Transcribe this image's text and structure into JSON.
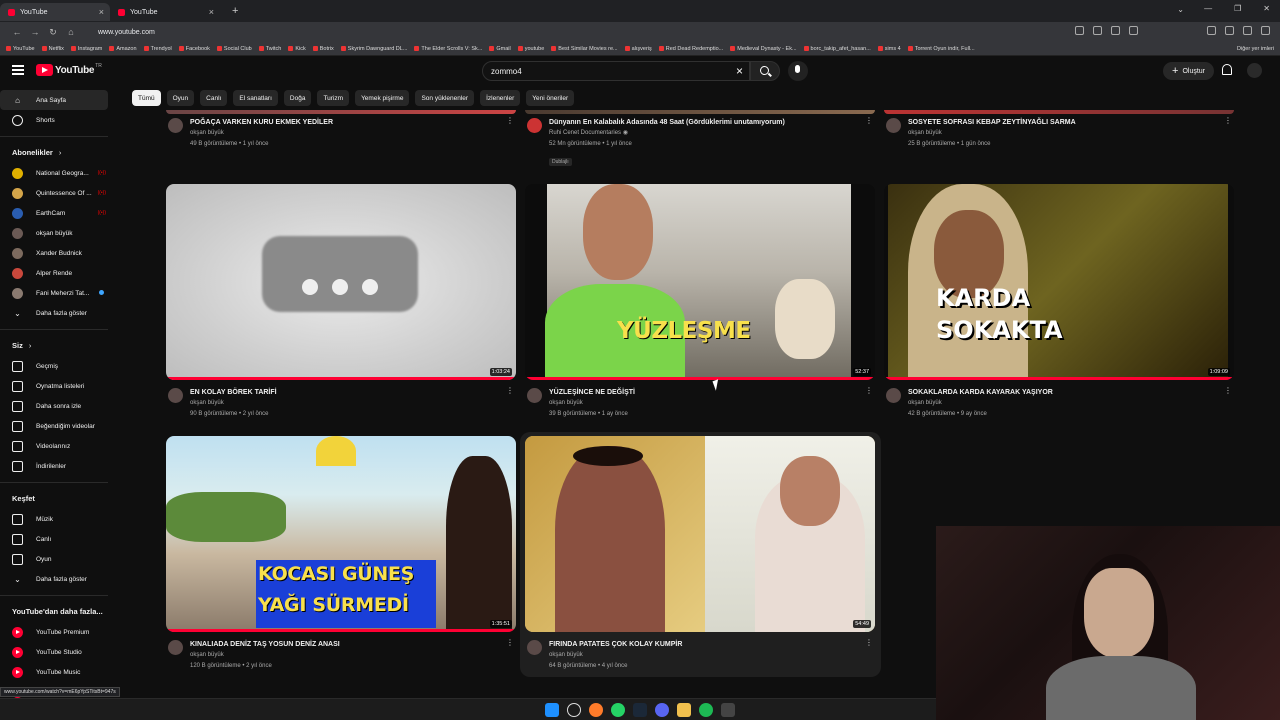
{
  "browser": {
    "tabs": [
      {
        "label": "YouTube",
        "active": true
      },
      {
        "label": "YouTube",
        "active": false
      }
    ],
    "url": "www.youtube.com",
    "bookmarks": [
      "YouTube",
      "Netflix",
      "Instagram",
      "Amazon",
      "Trendyol",
      "Facebook",
      "Social Club",
      "Twitch",
      "Kick",
      "Botrix",
      "Skyrim Dawnguard DL...",
      "The Elder Scrolls V: Sk...",
      "Gmail",
      "youtube",
      "Best Similar Movies re...",
      "alışveriş",
      "Red Dead Redemptio...",
      "Medieval Dynasty - Ek...",
      "borc_takip_afet_hasan...",
      "sims 4",
      "Torrent Oyun indir, Full..."
    ],
    "bookmarks_more": "Diğer yer imleri",
    "status_url": "www.youtube.com/watch?v=mE6pYpSTitsBt=947s"
  },
  "header": {
    "logo_text": "YouTube",
    "logo_region": "TR",
    "search_value": "zommo4",
    "create_label": "Oluştur"
  },
  "chips": [
    "Tümü",
    "Oyun",
    "Canlı",
    "El sanatları",
    "Doğa",
    "Turizm",
    "Yemek pişirme",
    "Son yüklenenler",
    "İzlenenler",
    "Yeni öneriler"
  ],
  "sidebar": {
    "main": [
      {
        "label": "Ana Sayfa",
        "icon": "home-icon",
        "active": true
      },
      {
        "label": "Shorts",
        "icon": "shorts-icon",
        "active": false
      }
    ],
    "subscriptions_title": "Abonelikler",
    "subscriptions": [
      {
        "label": "National Geogra...",
        "status": "live",
        "color": "#e0b000"
      },
      {
        "label": "Quintessence Of ...",
        "status": "live",
        "color": "#d4a54a"
      },
      {
        "label": "EarthCam",
        "status": "live",
        "color": "#2a5db0"
      },
      {
        "label": "okşan büyük",
        "status": "",
        "color": "#6b5a55"
      },
      {
        "label": "Xander Budnick",
        "status": "",
        "color": "#7c6a5e"
      },
      {
        "label": "Alper Rende",
        "status": "",
        "color": "#c9483c"
      },
      {
        "label": "Fani Meherzi Tat...",
        "status": "dot",
        "color": "#8a7a70"
      }
    ],
    "show_more": "Daha fazla göster",
    "you_title": "Siz",
    "you": [
      {
        "label": "Geçmiş",
        "icon": "history-icon"
      },
      {
        "label": "Oynatma listeleri",
        "icon": "playlist-icon"
      },
      {
        "label": "Daha sonra izle",
        "icon": "clock-icon"
      },
      {
        "label": "Beğendiğim videolar",
        "icon": "thumbs-up-icon"
      },
      {
        "label": "Videolarınız",
        "icon": "video-icon"
      },
      {
        "label": "İndirilenler",
        "icon": "download-icon"
      }
    ],
    "explore_title": "Keşfet",
    "explore": [
      {
        "label": "Müzik",
        "icon": "music-icon"
      },
      {
        "label": "Canlı",
        "icon": "live-icon"
      },
      {
        "label": "Oyun",
        "icon": "gamepad-icon"
      }
    ],
    "explore_more": "Daha fazla göster",
    "more_yt_title": "YouTube'dan daha fazla...",
    "more_yt": [
      "YouTube Premium",
      "YouTube Studio",
      "YouTube Music",
      "YouTube Kids"
    ]
  },
  "top_videos": [
    {
      "title": "POĞAÇA VARKEN KURU EKMEK YEDİLER",
      "channel": "okşan büyük",
      "stats": "49 B görüntüleme • 1 yıl önce"
    },
    {
      "title": "Dünyanın En Kalabalık Adasında 48 Saat (Gördüklerimi unutamıyorum)",
      "channel": "Ruhi Cenet Documentaries",
      "stats": "52 Mn görüntüleme • 1 yıl önce",
      "badge": "Dublajlı"
    },
    {
      "title": "SOSYETE SOFRASI KEBAP ZEYTİNYAĞLI SARMA",
      "channel": "okşan büyük",
      "stats": "25 B görüntüleme • 1 gün önce"
    }
  ],
  "videos": [
    {
      "title": "EN KOLAY BÖREK TARİFİ",
      "channel": "okşan büyük",
      "stats": "90 B görüntüleme • 2 yıl önce",
      "duration": "1:03:24",
      "progress": 1.0
    },
    {
      "title": "YÜZLEŞİNCE NE DEĞİŞTİ",
      "channel": "okşan büyük",
      "stats": "39 B görüntüleme • 1 ay önce",
      "duration": "52:37",
      "progress": 1.0,
      "overlay": "YÜZLEŞME"
    },
    {
      "title": "SOKAKLARDA KARDA KAYARAK YAŞIYOR",
      "channel": "okşan büyük",
      "stats": "42 B görüntüleme • 9 ay önce",
      "duration": "1:09:09",
      "progress": 1.0,
      "overlay_line1": "KARDA",
      "overlay_line2": "SOKAKTA"
    },
    {
      "title": "KINALIADA DENİZ TAŞ YOSUN DENİZ ANASI",
      "channel": "okşan büyük",
      "stats": "120 B görüntüleme • 2 yıl önce",
      "duration": "1:35:51",
      "progress": 1.0,
      "overlay_line1": "KOCASI GÜNEŞ",
      "overlay_line2": "YAĞI SÜRMEDİ"
    },
    {
      "title": "FIRINDA PATATES ÇOK KOLAY KUMPİR",
      "channel": "okşan büyük",
      "stats": "64 B görüntüleme • 4 yıl önce",
      "duration": "54:49",
      "progress": 0.0
    }
  ]
}
